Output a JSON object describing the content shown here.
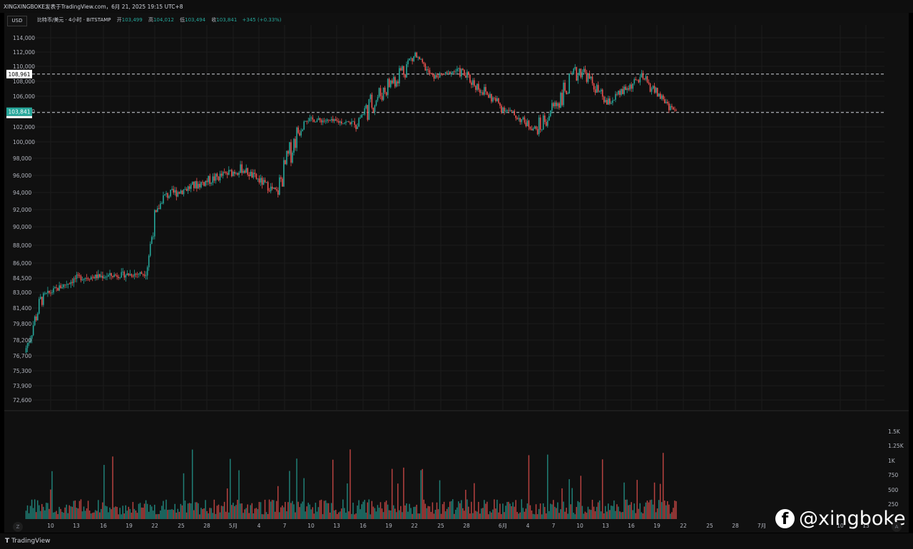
{
  "header": {
    "title": "XINGXINGBOKE发表于TradingView.com，6月 21, 2025 19:15 UTC+8"
  },
  "legend": {
    "symbol": "比特币/美元 · 4小时 · BITSTAMP",
    "open_label": "开",
    "open": "103,499",
    "high_label": "高",
    "high": "104,012",
    "low_label": "低",
    "low": "103,494",
    "close_label": "收",
    "close": "103,841",
    "change": "+345 (+0.33%)"
  },
  "currency": "USD",
  "markers": {
    "horizontal_level": "108,961",
    "last_price": "103,841"
  },
  "colors": {
    "up": "#26a69a",
    "down": "#ef5350",
    "background": "#101010",
    "grid": "#1c1c1c"
  },
  "watermark": {
    "icon": "facebook-icon",
    "handle": "@xingboke"
  },
  "footer": {
    "brand": "TradingView",
    "logo": "tv-logo-icon"
  },
  "chart_data": {
    "type": "candlestick",
    "symbol": "BTC/USD",
    "interval": "4h",
    "exchange": "BITSTAMP",
    "price_ticks": [
      "114,000",
      "112,000",
      "110,000",
      "108,000",
      "106,000",
      "104,000",
      "102,000",
      "100,000",
      "98,000",
      "96,000",
      "94,000",
      "92,000",
      "90,000",
      "88,000",
      "86,000",
      "84,500",
      "83,000",
      "81,400",
      "79,800",
      "78,200",
      "76,700",
      "75,300",
      "73,900",
      "72,600"
    ],
    "volume_ticks": [
      "1.5K",
      "1.25K",
      "1K",
      "750",
      "500",
      "250"
    ],
    "date_ticks": [
      "10",
      "13",
      "16",
      "19",
      "22",
      "25",
      "28",
      "5月",
      "4",
      "7",
      "10",
      "13",
      "16",
      "19",
      "22",
      "25",
      "28",
      "6月",
      "4",
      "7",
      "10",
      "13",
      "16",
      "19",
      "22",
      "25",
      "28",
      "7月",
      "10",
      "13"
    ],
    "horizontal_lines": [
      108961,
      103841
    ],
    "ohlc_key_points": [
      {
        "date": "Apr 7",
        "close": 77000
      },
      {
        "date": "Apr 9",
        "close": 82500
      },
      {
        "date": "Apr 13",
        "close": 84500
      },
      {
        "date": "Apr 21",
        "close": 85000
      },
      {
        "date": "Apr 22",
        "close": 91000
      },
      {
        "date": "Apr 23",
        "close": 93500
      },
      {
        "date": "May 2",
        "close": 96800
      },
      {
        "date": "May 6",
        "close": 94000
      },
      {
        "date": "May 9",
        "close": 103000
      },
      {
        "date": "May 15",
        "close": 102500
      },
      {
        "date": "May 22",
        "close": 111500
      },
      {
        "date": "May 24",
        "close": 108500
      },
      {
        "date": "May 27",
        "close": 109500
      },
      {
        "date": "Jun 1",
        "close": 104500
      },
      {
        "date": "Jun 5",
        "close": 101500
      },
      {
        "date": "Jun 10",
        "close": 109800
      },
      {
        "date": "Jun 13",
        "close": 105000
      },
      {
        "date": "Jun 17",
        "close": 108500
      },
      {
        "date": "Jun 21",
        "close": 103841
      }
    ]
  }
}
